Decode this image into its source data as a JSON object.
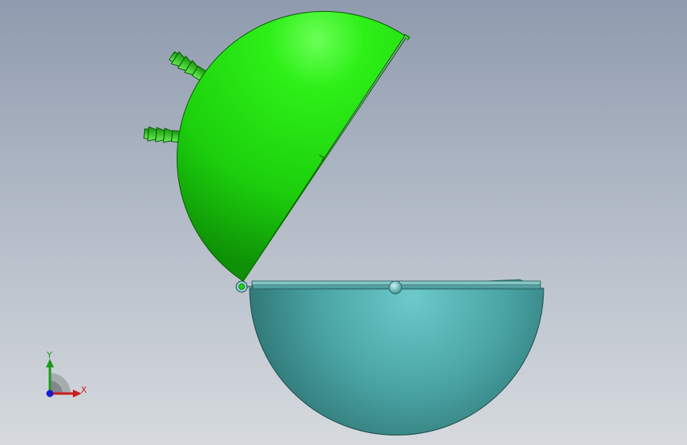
{
  "viewport": {
    "background_top": "#8f9bae",
    "background_bottom": "#d6dade"
  },
  "model": {
    "lid_color": "#22e010",
    "base_color": "#4aa8a8"
  },
  "triad": {
    "x_label": "X",
    "y_label": "Y",
    "x_color": "#c81e1e",
    "y_color": "#1a9a1a",
    "z_color": "#1a1ad0"
  }
}
